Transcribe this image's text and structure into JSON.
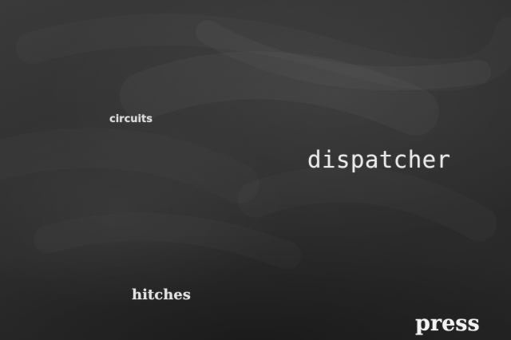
{
  "scene": {
    "background": "chalkboard",
    "board_color": "#2e2e2e",
    "chalk_color": "#e6e6e6"
  },
  "words": {
    "circuits": "circuits",
    "dispatcher": "dispatcher",
    "hitches": "hitches",
    "press": "press"
  }
}
